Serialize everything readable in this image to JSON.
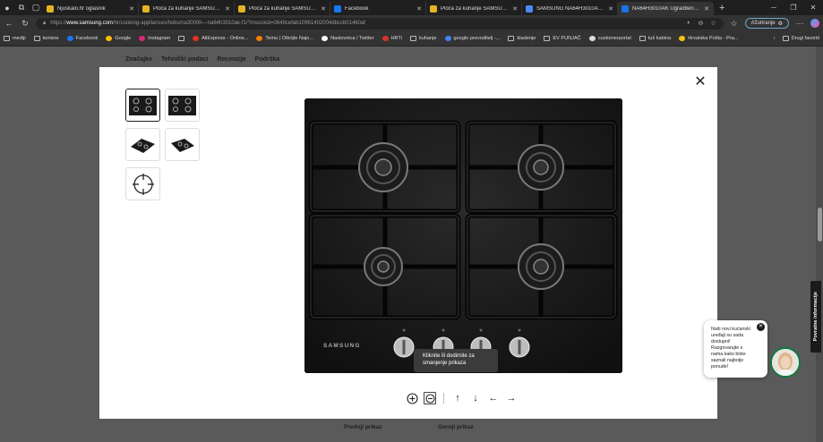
{
  "tabs": [
    {
      "label": "Njuskalo.hr oglasnik",
      "active": false,
      "color": "#e6b422"
    },
    {
      "label": "Ploča za kuhanje SAMSUNG N",
      "active": false,
      "color": "#e6b422"
    },
    {
      "label": "Ploča za kuhanje SAMSUNG N",
      "active": false,
      "color": "#e6b422"
    },
    {
      "label": "Facebook",
      "active": false,
      "color": "#1877f2"
    },
    {
      "label": "Ploča za kuhanje SAMSUNG N",
      "active": false,
      "color": "#e6b422"
    },
    {
      "label": "SAMSUNG NA64H3010AK/L1",
      "active": false,
      "color": "#4a8af4"
    },
    {
      "label": "NA64H3010AK Ugradbena plo",
      "active": true,
      "color": "#1a73e8"
    }
  ],
  "address": {
    "url_prefix": "https://",
    "host": "www.samsung.com",
    "path": "/hr/cooking-appliances/hobs/na3000h---na64h3010ak-f1/?msockid=0649cefab10961402004dbccb01460af",
    "update_label": "Ažuriranje"
  },
  "bookmarks": [
    {
      "label": "mediji",
      "icon": "folder-icon"
    },
    {
      "label": "korisne",
      "icon": "folder-icon"
    },
    {
      "label": "Facebook",
      "icon": "facebook-icon",
      "color": "#1877f2"
    },
    {
      "label": "Google",
      "icon": "google-icon",
      "color": "#fbbc05"
    },
    {
      "label": "Instagram",
      "icon": "instagram-icon",
      "color": "#d62976"
    },
    {
      "label": "",
      "icon": "globe-icon"
    },
    {
      "label": "AliExpress - Online...",
      "icon": "aliexpress-icon",
      "color": "#e43225"
    },
    {
      "label": "Temu | Otkrijte Najn...",
      "icon": "temu-icon",
      "color": "#f57c00"
    },
    {
      "label": "Naslovnica / Twitter",
      "icon": "x-icon",
      "color": "#ffffff"
    },
    {
      "label": "HRTi",
      "icon": "hrti-icon",
      "color": "#d9342b"
    },
    {
      "label": "kuhanje",
      "icon": "folder-icon"
    },
    {
      "label": "google prevoditelj -...",
      "icon": "translate-icon",
      "color": "#4285f4"
    },
    {
      "label": "kladenje",
      "icon": "folder-icon"
    },
    {
      "label": "EV PUNJAČ",
      "icon": "folder-icon"
    },
    {
      "label": "customerportal",
      "icon": "portal-icon",
      "color": "#dddddd"
    },
    {
      "label": "tuš kabina",
      "icon": "folder-icon"
    },
    {
      "label": "Hrvatska Pošta - Pra...",
      "icon": "post-icon",
      "color": "#f2c40f"
    }
  ],
  "bookmarks_other": "Drugi favoriti",
  "page_nav": [
    "Značajke",
    "Tehnički podaci",
    "Recenzije",
    "Podrška"
  ],
  "page_bottom": {
    "front_view": "Prednji prikaz",
    "top_view": "Gornji prikaz"
  },
  "side_tab_label": "Povratne informacije",
  "gallery": {
    "thumbnails": [
      {
        "name": "thumb-hob-top-1",
        "active": true
      },
      {
        "name": "thumb-hob-top-2",
        "active": false
      },
      {
        "name": "thumb-hob-angle-left",
        "active": false
      },
      {
        "name": "thumb-hob-angle-right",
        "active": false
      },
      {
        "name": "thumb-360-view",
        "active": false
      }
    ],
    "brand_label": "SAMSUNG",
    "tooltip_line1": "Kliknite ili dodirnite za",
    "tooltip_line2": "smanjenje prikaza"
  },
  "chat": {
    "lines": [
      "Naši novi kućanski",
      "uređaji su sada",
      "dostupni!",
      "Razgovarajte s",
      "nama kako biste",
      "saznali najbolje",
      "ponude!"
    ],
    "avatar_border_color": "#0a7b3e"
  }
}
